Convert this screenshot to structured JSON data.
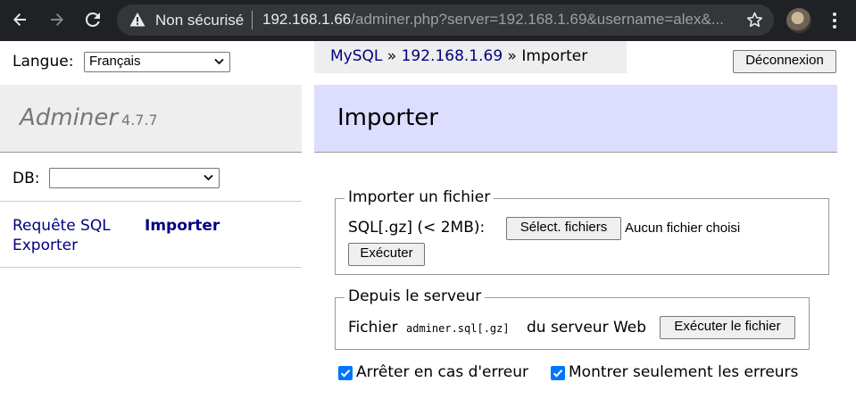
{
  "browser": {
    "security_label": "Non sécurisé",
    "url_host": "192.168.1.66",
    "url_rest": "/adminer.php?server=192.168.1.69&username=alex&..."
  },
  "language": {
    "label": "Langue:",
    "selected": "Français"
  },
  "breadcrumb": {
    "system": "MySQL",
    "separator1": " » ",
    "server": "192.168.1.69",
    "separator2": " » ",
    "current": "Importer"
  },
  "logout_label": "Déconnexion",
  "brand": {
    "name": "Adminer",
    "version": "4.7.7"
  },
  "db": {
    "label": "DB:",
    "selected": ""
  },
  "menu": {
    "sql_label": "Requête SQL",
    "import_label": "Importer",
    "export_label": "Exporter"
  },
  "page_title": "Importer",
  "upload": {
    "legend": "Importer un fichier",
    "field_label": "SQL[.gz] (< 2MB):",
    "choose_label": "Sélect. fichiers",
    "no_file_label": "Aucun fichier choisi",
    "execute_label": "Exécuter"
  },
  "server_import": {
    "legend": "Depuis le serveur",
    "prefix": "Fichier",
    "filename": "adminer.sql[.gz]",
    "suffix": "du serveur Web",
    "execute_label": "Exécuter le fichier"
  },
  "options": {
    "stop_on_error": {
      "label": "Arrêter en cas d'erreur",
      "checked": true
    },
    "only_errors": {
      "label": "Montrer seulement les erreurs",
      "checked": true
    }
  },
  "colors": {
    "link": "#000080",
    "title_bg": "#ddddff",
    "checkbox": "#0075ff"
  }
}
